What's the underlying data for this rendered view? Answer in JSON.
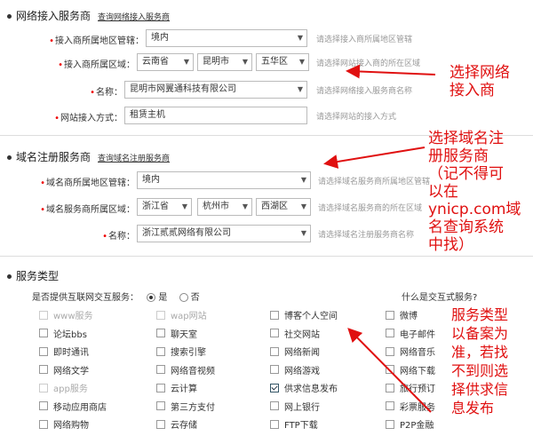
{
  "network_section": {
    "title": "网络接入服务商",
    "link": "查询网络接入服务商",
    "fields": {
      "region_label": "接入商所属地区管辖：",
      "region_value": "境内",
      "region_hint": "请选择接入商所属地区管辖",
      "area_label": "接入商所属区域：",
      "province": "云南省",
      "city": "昆明市",
      "district": "五华区",
      "area_hint": "请选择网站接入商的所在区域",
      "name_label": "名称：",
      "name_value": "昆明市网翼通科技有限公司",
      "name_hint": "请选择网络接入服务商名称",
      "method_label": "网站接入方式：",
      "method_value": "租赁主机",
      "method_hint": "请选择网站的接入方式"
    }
  },
  "domain_section": {
    "title": "域名注册服务商",
    "link": "查询域名注册服务商",
    "fields": {
      "region_label": "域名商所属地区管辖：",
      "region_value": "境内",
      "region_hint": "请选择域名服务商所属地区管辖",
      "area_label": "域名服务商所属区域：",
      "province": "浙江省",
      "city": "杭州市",
      "district": "西湖区",
      "area_hint": "请选择域名服务商的所在区域",
      "name_label": "名称：",
      "name_value": "浙江贰贰网络有限公司",
      "name_hint": "请选择域名注册服务商名称"
    }
  },
  "service_section": {
    "title": "服务类型",
    "interactive_question": "是否提供互联网交互服务：",
    "yes": "是",
    "no": "否",
    "what_is_link": "什么是交互式服务?",
    "items": [
      {
        "label": "www服务",
        "disabled": true,
        "checked": false
      },
      {
        "label": "wap网站",
        "disabled": true,
        "checked": false
      },
      {
        "label": "博客个人空间",
        "disabled": false,
        "checked": false
      },
      {
        "label": "微博",
        "disabled": false,
        "checked": false
      },
      {
        "label": "论坛bbs",
        "disabled": false,
        "checked": false
      },
      {
        "label": "聊天室",
        "disabled": false,
        "checked": false
      },
      {
        "label": "社交网站",
        "disabled": false,
        "checked": false
      },
      {
        "label": "电子邮件",
        "disabled": false,
        "checked": false
      },
      {
        "label": "即时通讯",
        "disabled": false,
        "checked": false
      },
      {
        "label": "搜索引擎",
        "disabled": false,
        "checked": false
      },
      {
        "label": "网络新闻",
        "disabled": false,
        "checked": false
      },
      {
        "label": "网络音乐",
        "disabled": false,
        "checked": false
      },
      {
        "label": "网络文学",
        "disabled": false,
        "checked": false
      },
      {
        "label": "网络音视频",
        "disabled": false,
        "checked": false
      },
      {
        "label": "网络游戏",
        "disabled": false,
        "checked": false
      },
      {
        "label": "网络下载",
        "disabled": false,
        "checked": false
      },
      {
        "label": "app服务",
        "disabled": true,
        "checked": false
      },
      {
        "label": "云计算",
        "disabled": false,
        "checked": false
      },
      {
        "label": "供求信息发布",
        "disabled": false,
        "checked": true
      },
      {
        "label": "旅行预订",
        "disabled": false,
        "checked": false
      },
      {
        "label": "移动应用商店",
        "disabled": false,
        "checked": false
      },
      {
        "label": "第三方支付",
        "disabled": false,
        "checked": false
      },
      {
        "label": "网上银行",
        "disabled": false,
        "checked": false
      },
      {
        "label": "彩票服务",
        "disabled": false,
        "checked": false
      },
      {
        "label": "网络购物",
        "disabled": false,
        "checked": false
      },
      {
        "label": "云存储",
        "disabled": false,
        "checked": false
      },
      {
        "label": "FTP下载",
        "disabled": false,
        "checked": false
      },
      {
        "label": "P2P金融",
        "disabled": false,
        "checked": false
      }
    ]
  },
  "annotations": {
    "a1_line1": "选择网络",
    "a1_line2": "接入商",
    "a2_line1": "选择域名注",
    "a2_line2": "册服务商",
    "a2_line3": "（记不得可",
    "a2_line4": "以在",
    "a2_line5": "ynicp.com域",
    "a2_line6": "名查询系统",
    "a2_line7": "中找）",
    "a3_line1": "服务类型",
    "a3_line2": "以备案为",
    "a3_line3": "准，若找",
    "a3_line4": "不到则选",
    "a3_line5": "择供求信",
    "a3_line6": "息发布",
    "color": "#e01010"
  }
}
